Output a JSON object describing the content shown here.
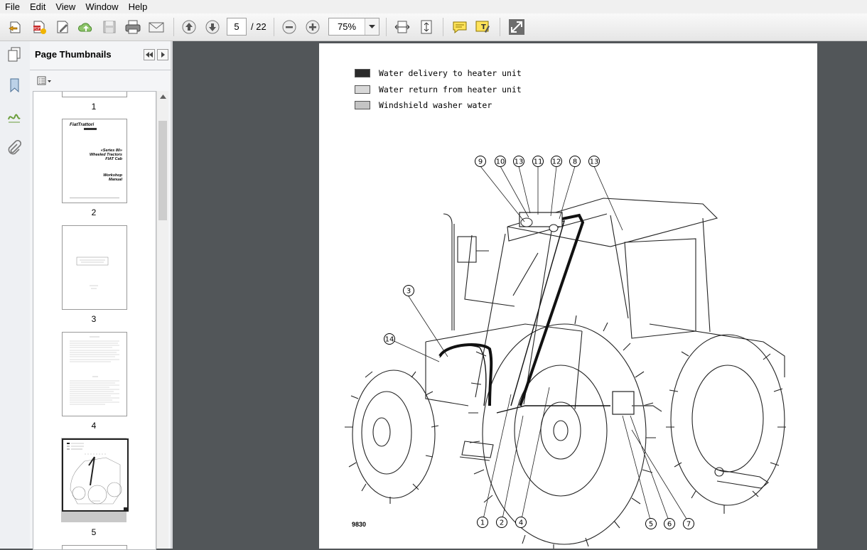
{
  "menu": [
    "File",
    "Edit",
    "View",
    "Window",
    "Help"
  ],
  "toolbar": {
    "current_page": "5",
    "total_pages": "/ 22",
    "zoom": "75%"
  },
  "thumbnails": {
    "title": "Page Thumbnails",
    "pages": [
      {
        "label": "1"
      },
      {
        "label": "2",
        "brand": "FiatTrattori",
        "series": "«Series 80»",
        "line2": "Wheeled Tractors",
        "line3": "FIAT Cab",
        "line4": "Workshop",
        "line5": "Manual"
      },
      {
        "label": "3"
      },
      {
        "label": "4"
      },
      {
        "label": "5"
      }
    ],
    "selected": "5"
  },
  "document": {
    "legend": [
      {
        "text": "Water delivery to heater unit",
        "color": "#2a2a2a"
      },
      {
        "text": "Water return from heater unit",
        "color": "#d8d8d8"
      },
      {
        "text": "Windshield washer water",
        "color": "#c4c4c4"
      }
    ],
    "figure_number": "9830",
    "callouts_top": [
      "9",
      "10",
      "13",
      "11",
      "12",
      "8",
      "13"
    ],
    "callouts_left": [
      "3",
      "14"
    ],
    "callouts_bottom": [
      "1",
      "2",
      "4",
      "5",
      "6",
      "7"
    ]
  },
  "colors": {
    "workspace": "#525659",
    "panel": "#f4f5f7",
    "toolbar": "#ececec"
  }
}
